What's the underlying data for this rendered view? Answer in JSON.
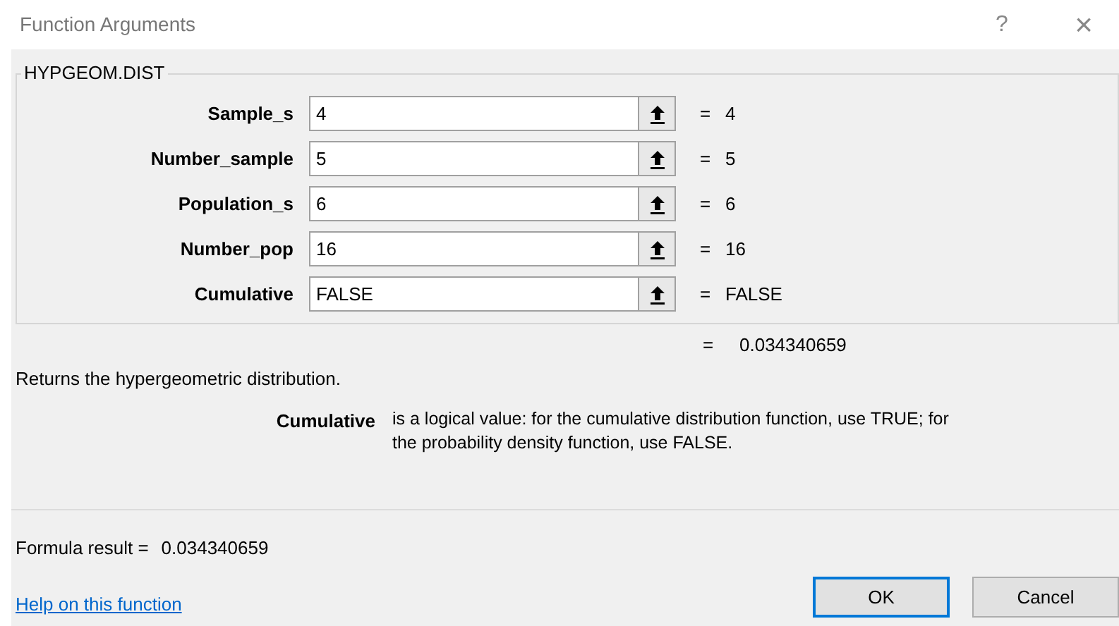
{
  "window": {
    "title": "Function Arguments",
    "help": "?",
    "close": "×"
  },
  "function_name": "HYPGEOM.DIST",
  "arguments": [
    {
      "label": "Sample_s",
      "value": "4",
      "equals": "=",
      "result": "4"
    },
    {
      "label": "Number_sample",
      "value": "5",
      "equals": "=",
      "result": "5"
    },
    {
      "label": "Population_s",
      "value": "6",
      "equals": "=",
      "result": "6"
    },
    {
      "label": "Number_pop",
      "value": "16",
      "equals": "=",
      "result": "16"
    },
    {
      "label": "Cumulative",
      "value": "FALSE",
      "equals": "=",
      "result": "FALSE"
    }
  ],
  "function_equals": "=",
  "function_result": "0.034340659",
  "description": "Returns the hypergeometric distribution.",
  "argument_help": {
    "name": "Cumulative",
    "lines": [
      "is a logical value: for the cumulative distribution function, use TRUE; for",
      "the probability density function, use FALSE."
    ]
  },
  "formula_result": {
    "label": "Formula result =",
    "value": "0.034340659"
  },
  "help_link": "Help on this function",
  "buttons": [
    {
      "label": "OK",
      "selected": true
    },
    {
      "label": "Cancel",
      "selected": false
    }
  ]
}
